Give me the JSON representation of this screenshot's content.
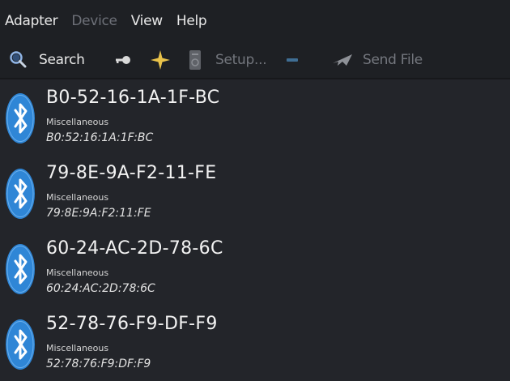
{
  "menubar": {
    "adapter": "Adapter",
    "device": "Device",
    "view": "View",
    "help": "Help"
  },
  "toolbar": {
    "search_label": "Search",
    "setup_label": "Setup...",
    "send_file_label": "Send File",
    "icons": {
      "search": "magnifier-icon",
      "trust": "key-icon",
      "favorite": "star-icon",
      "setup": "document-icon",
      "remove": "minus-icon",
      "send": "paper-plane-icon"
    }
  },
  "colors": {
    "bluetooth_badge": "#2f86d6",
    "background": "#23252a",
    "toolbar": "#1e2024"
  },
  "devices": [
    {
      "name": "B0-52-16-1A-1F-BC",
      "category": "Miscellaneous",
      "address": "B0:52:16:1A:1F:BC"
    },
    {
      "name": "79-8E-9A-F2-11-FE",
      "category": "Miscellaneous",
      "address": "79:8E:9A:F2:11:FE"
    },
    {
      "name": "60-24-AC-2D-78-6C",
      "category": "Miscellaneous",
      "address": "60:24:AC:2D:78:6C"
    },
    {
      "name": "52-78-76-F9-DF-F9",
      "category": "Miscellaneous",
      "address": "52:78:76:F9:DF:F9"
    }
  ]
}
